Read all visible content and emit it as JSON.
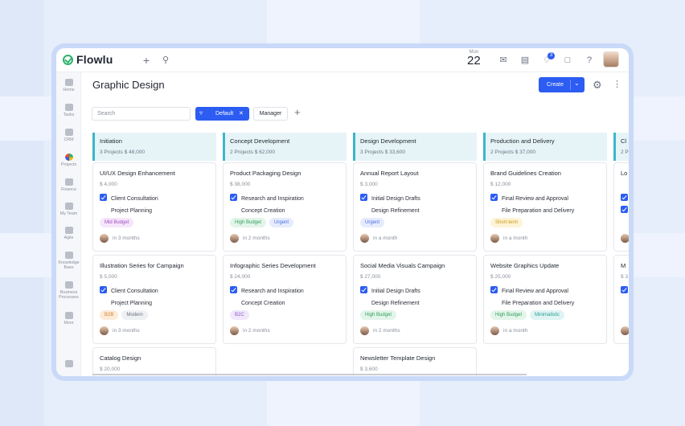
{
  "app": {
    "name": "Flowlu"
  },
  "topbar": {
    "month": "Mon",
    "day": "22",
    "notification_count": "3"
  },
  "sidebar": [
    {
      "label": "Home",
      "icon": "home-icon"
    },
    {
      "label": "Tasks",
      "icon": "tasks-icon"
    },
    {
      "label": "CRM",
      "icon": "crm-icon"
    },
    {
      "label": "Projects",
      "icon": "projects-icon",
      "active": true
    },
    {
      "label": "Finance",
      "icon": "finance-icon"
    },
    {
      "label": "My Team",
      "icon": "team-icon"
    },
    {
      "label": "Agile",
      "icon": "agile-icon"
    },
    {
      "label": "Knowledge Base",
      "icon": "knowledge-base-icon"
    },
    {
      "label": "Business Processes",
      "icon": "business-processes-icon"
    },
    {
      "label": "More",
      "icon": "more-icon"
    }
  ],
  "header": {
    "title": "Graphic Design",
    "create_label": "Create"
  },
  "filters": {
    "search_placeholder": "Search",
    "default_label": "Default",
    "manager_label": "Manager"
  },
  "columns": [
    {
      "title": "Initiation",
      "summary": "3 Projects  $ 48,000",
      "cards": [
        {
          "title": "UI/UX Design Enhancement",
          "amount": "$ 4,000",
          "tasks": [
            {
              "label": "Client Consultation",
              "done": true
            },
            {
              "label": "Project Planning",
              "done": false
            }
          ],
          "tags": [
            {
              "label": "Mid Budget",
              "bg": "#f6e6fb",
              "fg": "#a24cc4"
            }
          ],
          "when": "in 3 months"
        },
        {
          "title": "Illustration Series for Campaign",
          "amount": "$ 5,000",
          "tasks": [
            {
              "label": "Client Consultation",
              "done": true
            },
            {
              "label": "Project Planning",
              "done": false
            }
          ],
          "tags": [
            {
              "label": "B2B",
              "bg": "#fdebd9",
              "fg": "#d9822b"
            },
            {
              "label": "Modern",
              "bg": "#eef0f3",
              "fg": "#6b7280"
            }
          ],
          "when": "in 3 months"
        },
        {
          "title": "Catalog Design",
          "amount": "$ 20,000"
        }
      ]
    },
    {
      "title": "Concept Development",
      "summary": "2 Projects  $ 62,000",
      "cards": [
        {
          "title": "Product Packaging Design",
          "amount": "$ 38,000",
          "tasks": [
            {
              "label": "Research and Inspiration",
              "done": true
            },
            {
              "label": "Concept Creation",
              "done": false
            }
          ],
          "tags": [
            {
              "label": "High Budget",
              "bg": "#e3f5ea",
              "fg": "#2f9e5b"
            },
            {
              "label": "Urgent",
              "bg": "#e6ecfd",
              "fg": "#4a6ee0"
            }
          ],
          "when": "in 2 months"
        },
        {
          "title": "Infographic Series Development",
          "amount": "$ 24,000",
          "tasks": [
            {
              "label": "Research and Inspiration",
              "done": true
            },
            {
              "label": "Concept Creation",
              "done": false
            }
          ],
          "tags": [
            {
              "label": "B2C",
              "bg": "#f1e8fb",
              "fg": "#8b5cc4"
            }
          ],
          "when": "in 2 months"
        }
      ]
    },
    {
      "title": "Design Development",
      "summary": "3 Projects  $ 33,600",
      "cards": [
        {
          "title": "Annual Report Layout",
          "amount": "$ 3,000",
          "tasks": [
            {
              "label": "Initial Design Drafts",
              "done": true
            },
            {
              "label": "Design Refinement",
              "done": false
            }
          ],
          "tags": [
            {
              "label": "Urgent",
              "bg": "#e6ecfd",
              "fg": "#4a6ee0"
            }
          ],
          "when": "in a month"
        },
        {
          "title": "Social Media Visuals Campaign",
          "amount": "$ 27,000",
          "tasks": [
            {
              "label": "Initial Design Drafts",
              "done": true
            },
            {
              "label": "Design Refinement",
              "done": false
            }
          ],
          "tags": [
            {
              "label": "High Budget",
              "bg": "#e3f5ea",
              "fg": "#2f9e5b"
            }
          ],
          "when": "in 2 months"
        },
        {
          "title": "Newsletter Template Design",
          "amount": "$ 3,600"
        }
      ]
    },
    {
      "title": "Production and Delivery",
      "summary": "2 Projects  $ 37,000",
      "cards": [
        {
          "title": "Brand Guidelines Creation",
          "amount": "$ 12,000",
          "tasks": [
            {
              "label": "Final Review and Approval",
              "done": true
            },
            {
              "label": "File Preparation and Delivery",
              "done": false
            }
          ],
          "tags": [
            {
              "label": "Short-term",
              "bg": "#fdf3d6",
              "fg": "#c99a12"
            }
          ],
          "when": "in a month"
        },
        {
          "title": "Website Graphics Update",
          "amount": "$ 25,000",
          "tasks": [
            {
              "label": "Final Review and Approval",
              "done": true
            },
            {
              "label": "File Preparation and Delivery",
              "done": false
            }
          ],
          "tags": [
            {
              "label": "High Budget",
              "bg": "#e3f5ea",
              "fg": "#2f9e5b"
            },
            {
              "label": "Minimalistic",
              "bg": "#dff4f3",
              "fg": "#2a9d96"
            }
          ],
          "when": "in a month"
        }
      ]
    },
    {
      "title": "Cl",
      "summary": "2 P",
      "cards": [
        {
          "title": "Lo",
          "amount": "",
          "tasks": [
            {
              "label": "",
              "done": true
            },
            {
              "label": "",
              "done": true
            }
          ],
          "tags": [],
          "when": ""
        },
        {
          "title": "M",
          "amount": "$ 3",
          "tasks": [
            {
              "label": "",
              "done": true
            }
          ],
          "tags": [],
          "when": ""
        }
      ]
    }
  ]
}
